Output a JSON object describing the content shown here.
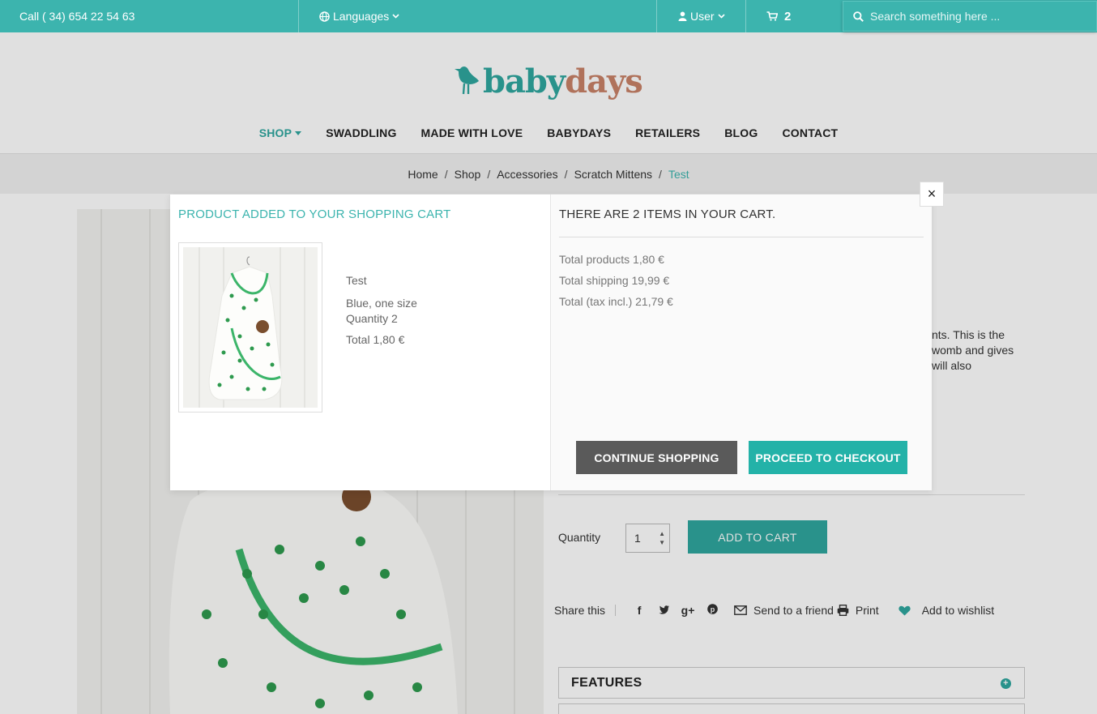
{
  "topbar": {
    "phone": "Call ( 34) 654 22 54 63",
    "languages_label": "Languages",
    "user_label": "User",
    "cart_count": "2",
    "search_placeholder": "Search something here ..."
  },
  "logo": {
    "part1": "baby",
    "part2": "days"
  },
  "nav": {
    "items": [
      {
        "label": "SHOP"
      },
      {
        "label": "SWADDLING"
      },
      {
        "label": "MADE WITH LOVE"
      },
      {
        "label": "BABYDAYS"
      },
      {
        "label": "RETAILERS"
      },
      {
        "label": "BLOG"
      },
      {
        "label": "CONTACT"
      }
    ]
  },
  "breadcrumb": {
    "items": [
      "Home",
      "Shop",
      "Accessories",
      "Scratch Mittens"
    ],
    "current": "Test"
  },
  "product": {
    "description_fragment": [
      "nts. This is the",
      "womb and gives",
      " will also"
    ],
    "quantity_label": "Quantity",
    "quantity_value": "1",
    "add_to_cart_label": "ADD TO CART",
    "share_label": "Share this",
    "send_to_friend_label": "Send to a friend",
    "print_label": "Print",
    "wishlist_label": "Add to wishlist",
    "features_label": "FEATURES"
  },
  "modal": {
    "title": "PRODUCT ADDED TO YOUR SHOPPING CART",
    "product_name": "Test",
    "product_attributes": "Blue, one size",
    "quantity_text": "Quantity  2",
    "total_text": "Total  1,80 €",
    "cart_title": "THERE ARE 2 ITEMS IN YOUR CART.",
    "total_products_text": "Total products 1,80 €",
    "total_shipping_text": "Total shipping  19,99 €",
    "total_tax_text": "Total (tax incl.) 21,79 €",
    "continue_label": "CONTINUE SHOPPING",
    "checkout_label": "PROCEED TO CHECKOUT",
    "close_label": "×"
  },
  "colors": {
    "brand_teal": "#3cb4ae",
    "logo_accent": "#c98268",
    "continue_button": "#5a5a5a",
    "checkout_button": "#23b2a8"
  },
  "icons": {
    "globe": "globe-icon",
    "user": "user-icon",
    "cart": "cart-icon",
    "search": "search-icon",
    "close": "close-icon",
    "heart": "heart-icon",
    "envelope": "envelope-icon",
    "print": "print-icon"
  }
}
